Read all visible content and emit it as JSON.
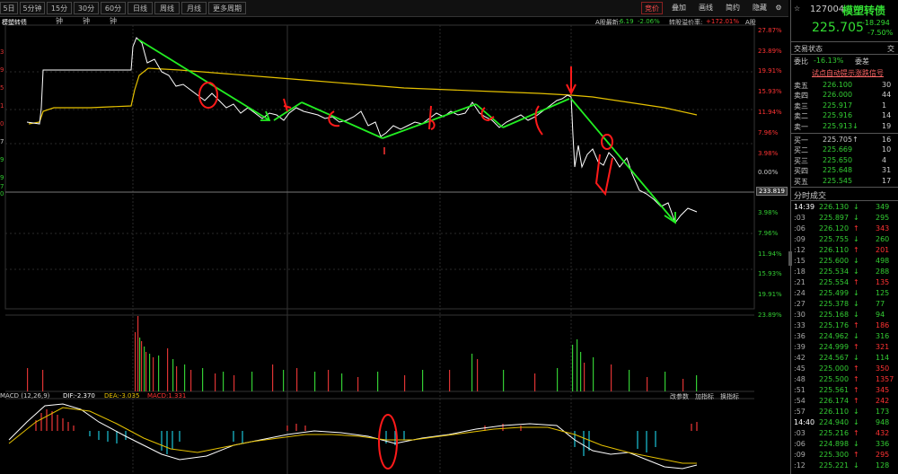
{
  "toolbar": {
    "periods": [
      "5日",
      "5分钟",
      "15分钟",
      "30分钟",
      "60分钟",
      "日线",
      "周线",
      "月线",
      "更多周期"
    ],
    "right_tabs": [
      "竞价",
      "叠加",
      "画线",
      "简约",
      "隐藏"
    ],
    "active_tab": "竞价"
  },
  "chart_header": {
    "title": "模塑转债",
    "stock_text": "A股最新:",
    "stock_value": "6.19",
    "stock_change": "-2.06%",
    "premium_text": "转股溢价率:",
    "premium_value": "+172.01%",
    "a_label": "A股"
  },
  "price_axis": {
    "right_ticks": [
      "27.87%",
      "23.89%",
      "19.91%",
      "15.93%",
      "11.94%",
      "7.96%",
      "3.98%",
      "0.00%",
      "3.98%",
      "7.96%",
      "11.94%",
      "15.93%",
      "19.91%",
      "23.89%"
    ],
    "current_price_box": "233.819"
  },
  "left_axis_labels": [
    "3",
    "9",
    "5",
    "1",
    "0",
    "7",
    "9",
    "9",
    "7",
    "0"
  ],
  "macd": {
    "label": "MACD (12,26,9)",
    "dif": "DIF:-2.370",
    "dea": "DEA:-3.035",
    "macd": "MACD:1.331",
    "buttons": [
      "改参数",
      "加指标",
      "换指标"
    ]
  },
  "quote": {
    "code": "127004",
    "name": "模塑转债",
    "price": "225.705",
    "change": "-18.294",
    "change_pct": "-7.50%",
    "status_label": "交易状态",
    "status_value": "交",
    "weibi_label": "委比",
    "weibi_value": "-16.13%",
    "weicha_label": "委差",
    "link": "试点自动提示涨跌信号"
  },
  "order_book": {
    "asks": [
      {
        "label": "卖五",
        "price": "226.100",
        "vol": "30",
        "arrow": ""
      },
      {
        "label": "卖四",
        "price": "226.000",
        "vol": "44",
        "arrow": ""
      },
      {
        "label": "卖三",
        "price": "225.917",
        "vol": "1",
        "arrow": ""
      },
      {
        "label": "卖二",
        "price": "225.916",
        "vol": "14",
        "arrow": ""
      },
      {
        "label": "卖一",
        "price": "225.913",
        "vol": "19",
        "arrow": "↓"
      }
    ],
    "bids": [
      {
        "label": "买一",
        "price": "225.705",
        "vol": "16",
        "arrow": "↑"
      },
      {
        "label": "买二",
        "price": "225.669",
        "vol": "10",
        "arrow": ""
      },
      {
        "label": "买三",
        "price": "225.650",
        "vol": "4",
        "arrow": ""
      },
      {
        "label": "买四",
        "price": "225.648",
        "vol": "31",
        "arrow": ""
      },
      {
        "label": "买五",
        "price": "225.545",
        "vol": "17",
        "arrow": ""
      }
    ]
  },
  "tick_section": {
    "title": "分时成交",
    "trades": [
      {
        "time": "14:39",
        "price": "226.130",
        "arrow": "↓",
        "vol": "349",
        "c": "g"
      },
      {
        "time": ":03",
        "price": "225.897",
        "arrow": "↓",
        "vol": "295",
        "c": "g"
      },
      {
        "time": ":06",
        "price": "226.120",
        "arrow": "↑",
        "vol": "343",
        "c": "r"
      },
      {
        "time": ":09",
        "price": "225.755",
        "arrow": "↓",
        "vol": "260",
        "c": "g"
      },
      {
        "time": ":12",
        "price": "226.110",
        "arrow": "↑",
        "vol": "201",
        "c": "r"
      },
      {
        "time": ":15",
        "price": "225.600",
        "arrow": "↓",
        "vol": "498",
        "c": "g"
      },
      {
        "time": ":18",
        "price": "225.534",
        "arrow": "↓",
        "vol": "288",
        "c": "g"
      },
      {
        "time": ":21",
        "price": "225.554",
        "arrow": "↑",
        "vol": "135",
        "c": "r"
      },
      {
        "time": ":24",
        "price": "225.499",
        "arrow": "↓",
        "vol": "125",
        "c": "g"
      },
      {
        "time": ":27",
        "price": "225.378",
        "arrow": "↓",
        "vol": "77",
        "c": "g"
      },
      {
        "time": ":30",
        "price": "225.168",
        "arrow": "↓",
        "vol": "94",
        "c": "g"
      },
      {
        "time": ":33",
        "price": "225.176",
        "arrow": "↑",
        "vol": "186",
        "c": "r"
      },
      {
        "time": ":36",
        "price": "224.962",
        "arrow": "↓",
        "vol": "316",
        "c": "g"
      },
      {
        "time": ":39",
        "price": "224.999",
        "arrow": "↑",
        "vol": "321",
        "c": "r"
      },
      {
        "time": ":42",
        "price": "224.567",
        "arrow": "↓",
        "vol": "114",
        "c": "g"
      },
      {
        "time": ":45",
        "price": "225.000",
        "arrow": "↑",
        "vol": "350",
        "c": "r"
      },
      {
        "time": ":48",
        "price": "225.500",
        "arrow": "↑",
        "vol": "1357",
        "c": "r"
      },
      {
        "time": ":51",
        "price": "225.561",
        "arrow": "↑",
        "vol": "345",
        "c": "r"
      },
      {
        "time": ":54",
        "price": "226.174",
        "arrow": "↑",
        "vol": "242",
        "c": "r"
      },
      {
        "time": ":57",
        "price": "226.110",
        "arrow": "↓",
        "vol": "173",
        "c": "g"
      },
      {
        "time": "14:40",
        "price": "224.940",
        "arrow": "↓",
        "vol": "948",
        "c": "g"
      },
      {
        "time": ":03",
        "price": "225.216",
        "arrow": "↑",
        "vol": "432",
        "c": "r"
      },
      {
        "time": ":06",
        "price": "224.898",
        "arrow": "↓",
        "vol": "336",
        "c": "g"
      },
      {
        "time": ":09",
        "price": "225.300",
        "arrow": "↑",
        "vol": "295",
        "c": "r"
      },
      {
        "time": ":12",
        "price": "225.221",
        "arrow": "↓",
        "vol": "128",
        "c": "g"
      }
    ]
  },
  "colors": {
    "up": "#ff3333",
    "down": "#33cc33",
    "price_line": "#ffffff",
    "avg_line": "#e5c100",
    "annotation": "#ff1a1a",
    "arrow": "#22ee22"
  }
}
